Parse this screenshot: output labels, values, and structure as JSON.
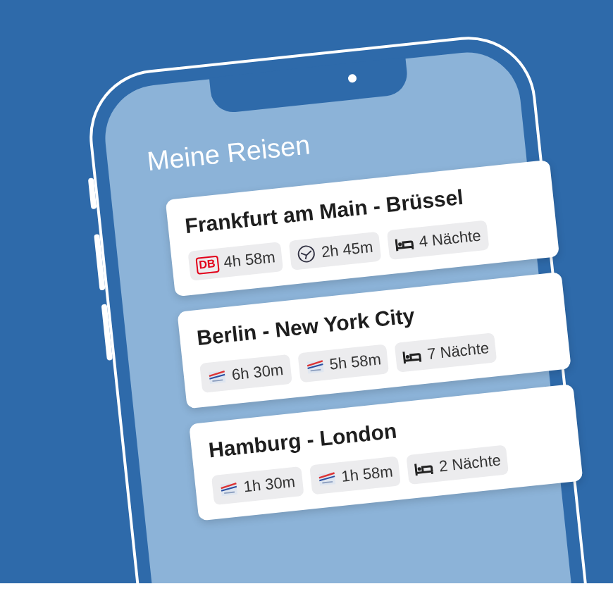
{
  "screen_title": "Meine Reisen",
  "trips": [
    {
      "route": "Frankfurt am Main - Brüssel",
      "chips": [
        {
          "kind": "rail",
          "logo_text": "DB",
          "label": "4h 58m"
        },
        {
          "kind": "flight",
          "label": "2h 45m"
        },
        {
          "kind": "hotel",
          "label": "4 Nächte"
        }
      ]
    },
    {
      "route": "Berlin - New York City",
      "chips": [
        {
          "kind": "airline",
          "label": "6h 30m"
        },
        {
          "kind": "airline",
          "label": "5h 58m"
        },
        {
          "kind": "hotel",
          "label": "7 Nächte"
        }
      ]
    },
    {
      "route": "Hamburg - London",
      "chips": [
        {
          "kind": "airline",
          "label": "1h 30m"
        },
        {
          "kind": "airline",
          "label": "1h 58m"
        },
        {
          "kind": "hotel",
          "label": "2 Nächte"
        }
      ]
    }
  ]
}
